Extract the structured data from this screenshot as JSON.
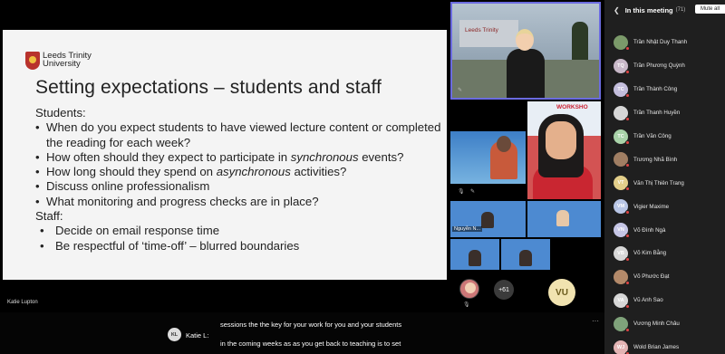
{
  "slide": {
    "logo_line1": "Leeds Trinity",
    "logo_line2": "University",
    "title": "Setting expectations – students and staff",
    "students_heading": "Students:",
    "student_items": [
      "When do you expect students to have viewed lecture content or completed the reading for each week?",
      "How often should they expect to participate in ",
      "How long should they spend on ",
      "Discuss online professionalism",
      "What monitoring and progress checks are in place?"
    ],
    "item2_em": "synchronous",
    "item2_tail": " events?",
    "item3_em": "asynchronous",
    "item3_tail": " activities?",
    "staff_heading": "Staff:",
    "staff_items": [
      "Decide on email response time",
      "Be respectful of ‘time-off’ – blurred boundaries"
    ],
    "presenter": "Katie Lupton"
  },
  "videos": {
    "main_sign": "Leeds Trinity",
    "tile_b_text": "WORKSHO",
    "tile_c_label": "Nguyễn N...",
    "more_count": "+61",
    "vu_initials": "VU"
  },
  "panel": {
    "title": "In this meeting",
    "count": "(71)",
    "mute_all": "Mute all",
    "participants": [
      {
        "name": "Trần Nhật Duy Thanh",
        "initials": "",
        "color": "#7b9a6a"
      },
      {
        "name": "Trần Phương Quỳnh",
        "initials": "TQ",
        "color": "#c8b8c8"
      },
      {
        "name": "Trần Thành Công",
        "initials": "TC",
        "color": "#c4bedd"
      },
      {
        "name": "Trần Thanh Huyền",
        "initials": "",
        "color": "#d7d7d7"
      },
      {
        "name": "Trần Văn Công",
        "initials": "TC",
        "color": "#a9d3a9"
      },
      {
        "name": "Trương Nhã Bình",
        "initials": "",
        "color": "#a07e63"
      },
      {
        "name": "Văn Thị Thiên Trang",
        "initials": "VT",
        "color": "#e3cf8a"
      },
      {
        "name": "Vigier Maxime",
        "initials": "VM",
        "color": "#b9c6e6"
      },
      {
        "name": "Võ Đình Ngà",
        "initials": "VN",
        "color": "#c6c6e6"
      },
      {
        "name": "Võ Kim Bằng",
        "initials": "VB",
        "color": "#d7d7d7"
      },
      {
        "name": "Võ Phước Đạt",
        "initials": "",
        "color": "#b48a6a"
      },
      {
        "name": "Vũ Anh Sao",
        "initials": "VA",
        "color": "#d7d7d7"
      },
      {
        "name": "Vương Minh Châu",
        "initials": "",
        "color": "#7fa27a"
      },
      {
        "name": "Wold Brian James",
        "initials": "WJ",
        "color": "#e3b3b3"
      }
    ]
  },
  "caption": {
    "initials": "KL",
    "speaker": "Katie L:",
    "line1": "sessions the the key for your work for you and your students",
    "line2": "in the coming weeks as as you get back to teaching is to set"
  }
}
